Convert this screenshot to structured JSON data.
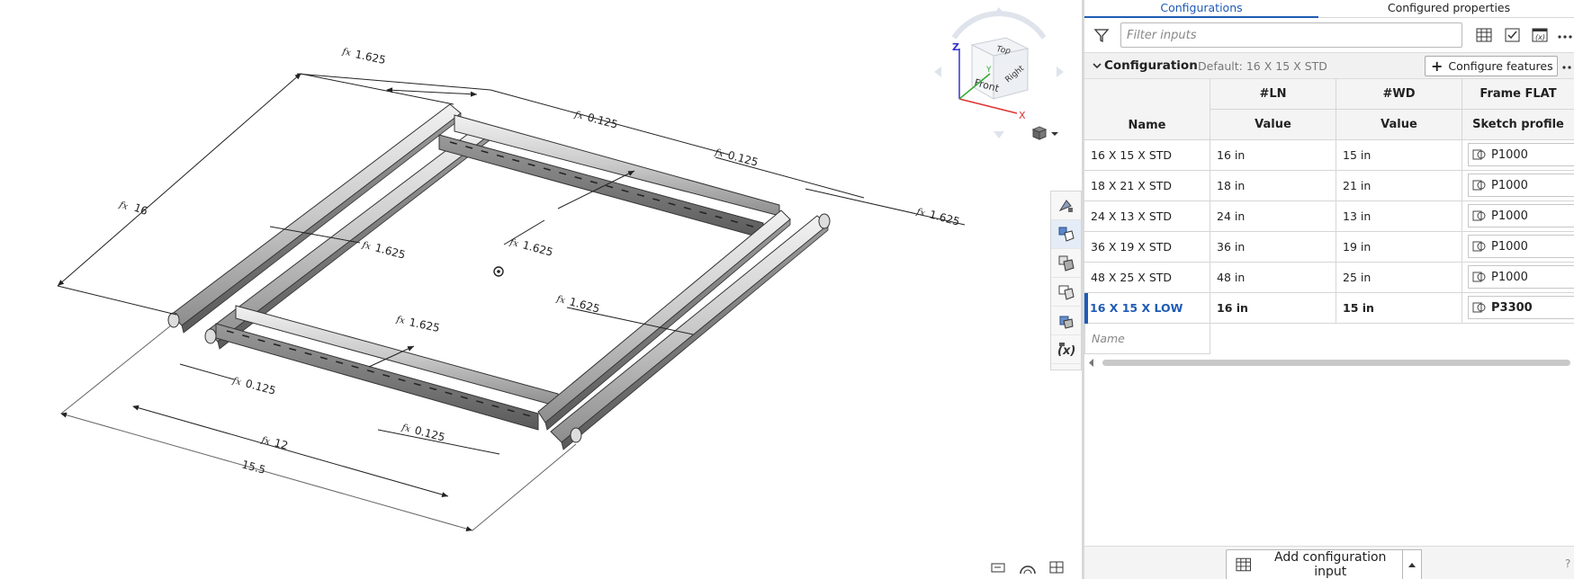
{
  "tabs": {
    "configurations": "Configurations",
    "configured_properties": "Configured properties"
  },
  "filter": {
    "placeholder": "Filter inputs"
  },
  "configuration": {
    "title": "Configuration",
    "default_label": "Default: 16 X 15 X STD",
    "configure_features": "Configure features"
  },
  "table": {
    "header_top": [
      "",
      "#LN",
      "#WD",
      "Frame FLAT"
    ],
    "header_bottom": [
      "Name",
      "Value",
      "Value",
      "Sketch profile"
    ],
    "rows": [
      {
        "name": "16 X 15 X STD",
        "ln": "16 in",
        "wd": "15 in",
        "profile": "P1000"
      },
      {
        "name": "18 X 21 X STD",
        "ln": "18 in",
        "wd": "21 in",
        "profile": "P1000"
      },
      {
        "name": "24 X 13 X STD",
        "ln": "24 in",
        "wd": "13 in",
        "profile": "P1000"
      },
      {
        "name": "36 X 19 X STD",
        "ln": "36 in",
        "wd": "19 in",
        "profile": "P1000"
      },
      {
        "name": "48 X 25 X STD",
        "ln": "48 in",
        "wd": "25 in",
        "profile": "P1000"
      },
      {
        "name": "16 X 15 X LOW",
        "ln": "16 in",
        "wd": "15 in",
        "profile": "P3300"
      }
    ],
    "selected_index": 5,
    "new_name_placeholder": "Name"
  },
  "add_config_input": "Add configuration input",
  "help": "?",
  "view_cube": {
    "top": "Top",
    "front": "Front",
    "right": "Right",
    "x": "X",
    "y": "Y",
    "z": "Z"
  },
  "dimensions": {
    "d1": "1.625",
    "d2": "0.125",
    "d3": "0.125",
    "d4": "1.625",
    "d5": "16",
    "d6": "1.625",
    "d7": "1.625",
    "d8": "1.625",
    "d9": "1.625",
    "d10": "0.125",
    "d11": "0.125",
    "d12": "12",
    "d13": "15.5"
  },
  "colors": {
    "accent": "#1f5bb5",
    "origin_x": "#d33",
    "origin_y": "#3a3",
    "origin_z": "#33c"
  }
}
